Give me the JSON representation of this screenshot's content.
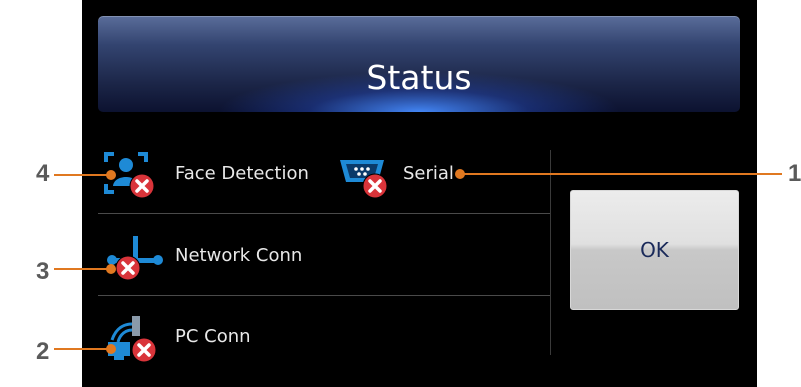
{
  "dialog": {
    "title": "Status",
    "ok_label": "OK"
  },
  "status_items": {
    "face_detection": {
      "label": "Face Detection",
      "icon": "face-detection-icon",
      "state": "error"
    },
    "serial": {
      "label": "Serial",
      "icon": "serial-port-icon",
      "state": "error"
    },
    "network": {
      "label": "Network Conn",
      "icon": "network-icon",
      "state": "error"
    },
    "pc": {
      "label": "PC Conn",
      "icon": "pc-connection-icon",
      "state": "error"
    }
  },
  "callouts": {
    "c4": "4",
    "c3": "3",
    "c2": "2",
    "c1": "1"
  },
  "colors": {
    "callout": "#e07820",
    "error_badge": "#d9343a",
    "icon_blue": "#1e8ad6"
  }
}
